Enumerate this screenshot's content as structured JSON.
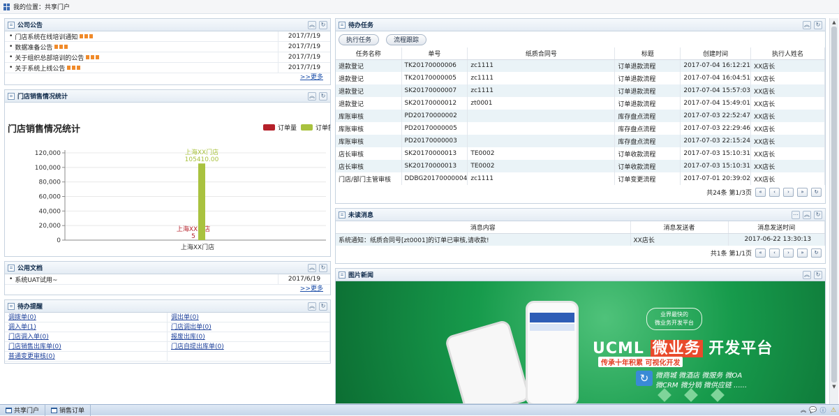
{
  "breadcrumb": "我的位置：共享门户",
  "announcements": {
    "title": "公司公告",
    "items": [
      {
        "text": "门店系统在线培训通知",
        "date": "2017/7/19"
      },
      {
        "text": "数据准备公告",
        "date": "2017/7/19"
      },
      {
        "text": "关于组织总部培训的公告",
        "date": "2017/7/19"
      },
      {
        "text": "关于系统上线公告",
        "date": "2017/7/19"
      }
    ],
    "more": ">>更多"
  },
  "sales": {
    "title": "门店销售情况统计",
    "chart_title": "门店销售情况统计",
    "legend": [
      "订单量",
      "订单额"
    ],
    "colors": {
      "orders": "#b5202a",
      "amount": "#a9c23f"
    }
  },
  "chart_data": {
    "type": "bar",
    "title": "门店销售情况统计",
    "categories": [
      "上海XX门店"
    ],
    "series": [
      {
        "name": "订单量",
        "values": [
          5
        ]
      },
      {
        "name": "订单额",
        "values": [
          105410.0
        ]
      }
    ],
    "data_labels": [
      [
        "上海XX门店",
        "5"
      ],
      [
        "上海XX门店",
        "105410.00"
      ]
    ],
    "ylim": [
      0,
      120000
    ],
    "yticks": [
      "0",
      "20,000",
      "40,000",
      "60,000",
      "80,000",
      "100,000",
      "120,000"
    ],
    "legend": "top-right"
  },
  "docs": {
    "title": "公用文档",
    "items": [
      {
        "text": "系统UAT试用~",
        "date": "2017/6/19"
      }
    ],
    "more": ">>更多"
  },
  "reminders": {
    "title": "待办提醒",
    "items": [
      "调拨单(0)",
      "调出单(0)",
      "调入单(1)",
      "门店调出单(0)",
      "门店调入单(0)",
      "报废出库(0)",
      "门店销售出库单(0)",
      "门店自提出库单(0)",
      "普通变更审核(0)",
      ""
    ]
  },
  "tasks": {
    "title": "待办任务",
    "buttons": [
      "执行任务",
      "流程跟踪"
    ],
    "columns": [
      "任务名称",
      "单号",
      "纸质合同号",
      "标题",
      "创建时间",
      "执行人姓名"
    ],
    "rows": [
      [
        "退款登记",
        "TK20170000006",
        "zc1111",
        "订单退款流程",
        "2017-07-04 16:12:21",
        "XX店长"
      ],
      [
        "退款登记",
        "TK20170000005",
        "zc1111",
        "订单退款流程",
        "2017-07-04 16:04:51",
        "XX店长"
      ],
      [
        "退款登记",
        "SK20170000007",
        "zc1111",
        "订单退款流程",
        "2017-07-04 15:57:03",
        "XX店长"
      ],
      [
        "退款登记",
        "SK20170000012",
        "zt0001",
        "订单退款流程",
        "2017-07-04 15:49:01",
        "XX店长"
      ],
      [
        "库账审核",
        "PD20170000002",
        "",
        "库存盘点流程",
        "2017-07-03 22:52:47",
        "XX店长"
      ],
      [
        "库账审核",
        "PD20170000005",
        "",
        "库存盘点流程",
        "2017-07-03 22:29:46",
        "XX店长"
      ],
      [
        "库账审核",
        "PD20170000003",
        "",
        "库存盘点流程",
        "2017-07-03 22:15:24",
        "XX店长"
      ],
      [
        "店长审核",
        "SK20170000013",
        "TE0002",
        "订单收款流程",
        "2017-07-03 15:10:31",
        "XX店长"
      ],
      [
        "店长审核",
        "SK20170000013",
        "TE0002",
        "订单收款流程",
        "2017-07-03 15:10:31",
        "XX店长"
      ],
      [
        "门店/部门主管审核",
        "DDBG20170000004",
        "zc1111",
        "订单变更流程",
        "2017-07-01 20:39:02",
        "XX店长"
      ]
    ],
    "pager_text": "共24条 第1/3页"
  },
  "messages": {
    "title": "未读消息",
    "columns": [
      "消息内容",
      "消息发送者",
      "消息发送时间"
    ],
    "rows": [
      [
        "系统通知：纸质合同号[zt0001]的订单已审核,请收款!",
        "XX店长",
        "2017-06-22 13:30:13"
      ]
    ],
    "pager_text": "共1条 第1/1页"
  },
  "news": {
    "title": "图片新闻",
    "badge_line1": "业界最快的",
    "badge_line2": "微业务开发平台",
    "headline_a": "UCML",
    "headline_b": "微业务",
    "headline_c": "开发平台",
    "tagline": "传承十年积累  可视化开发",
    "features1": "微商城  微酒店  微服务  微OA",
    "features2": "微CRM  微分销  微供应链  ......"
  },
  "bottom_tabs": [
    "共享门户",
    "销售订单"
  ]
}
